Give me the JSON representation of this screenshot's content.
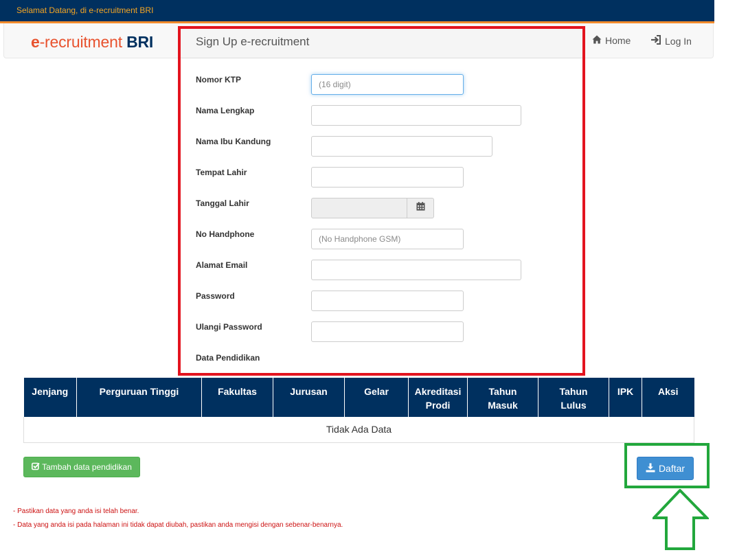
{
  "topbar": {
    "welcome": "Selamat Datang, di e-recruitment BRI"
  },
  "navbar": {
    "logo": {
      "prefix": "e",
      "middle": "-recruitment ",
      "brand": "BRI"
    },
    "home_label": "Home",
    "login_label": "Log In",
    "home_icon": "home-icon",
    "login_icon": "log-in-icon"
  },
  "form": {
    "title": "Sign Up e-recruitment",
    "fields": {
      "ktp": {
        "label": "Nomor KTP",
        "placeholder": "(16 digit)",
        "value": ""
      },
      "full_name": {
        "label": "Nama Lengkap",
        "value": ""
      },
      "mother_name": {
        "label": "Nama Ibu Kandung",
        "value": ""
      },
      "birth_place": {
        "label": "Tempat Lahir",
        "value": ""
      },
      "birth_date": {
        "label": "Tanggal Lahir",
        "value": "",
        "icon": "calendar-icon"
      },
      "phone": {
        "label": "No Handphone",
        "placeholder": "(No Handphone GSM)",
        "value": ""
      },
      "email": {
        "label": "Alamat Email",
        "value": ""
      },
      "password": {
        "label": "Password",
        "value": ""
      },
      "password_repeat": {
        "label": "Ulangi Password",
        "value": ""
      }
    },
    "education_label": "Data Pendidikan"
  },
  "education_table": {
    "headers": [
      [
        "Jenjang"
      ],
      [
        "Perguruan Tinggi"
      ],
      [
        "Fakultas"
      ],
      [
        "Jurusan"
      ],
      [
        "Gelar"
      ],
      [
        "Akreditasi",
        "Prodi"
      ],
      [
        "Tahun",
        "Masuk"
      ],
      [
        "Tahun",
        "Lulus"
      ],
      [
        "IPK"
      ],
      [
        "Aksi"
      ]
    ],
    "empty_text": "Tidak Ada Data"
  },
  "buttons": {
    "add_education": "Tambah data pendidikan",
    "add_education_icon": "check-square-icon",
    "register": "Daftar",
    "register_icon": "download-icon"
  },
  "notes": [
    "- Pastikan data yang anda isi telah benar.",
    "- Data yang anda isi pada halaman ini tidak dapat diubah, pastikan anda mengisi dengan sebenar-benarnya."
  ],
  "colors": {
    "navy": "#00305f",
    "orange": "#f28b2c",
    "highlight_red": "#e3141f",
    "highlight_green": "#22a73c",
    "button_green": "#5cb85c",
    "button_blue": "#3f8fd2"
  }
}
